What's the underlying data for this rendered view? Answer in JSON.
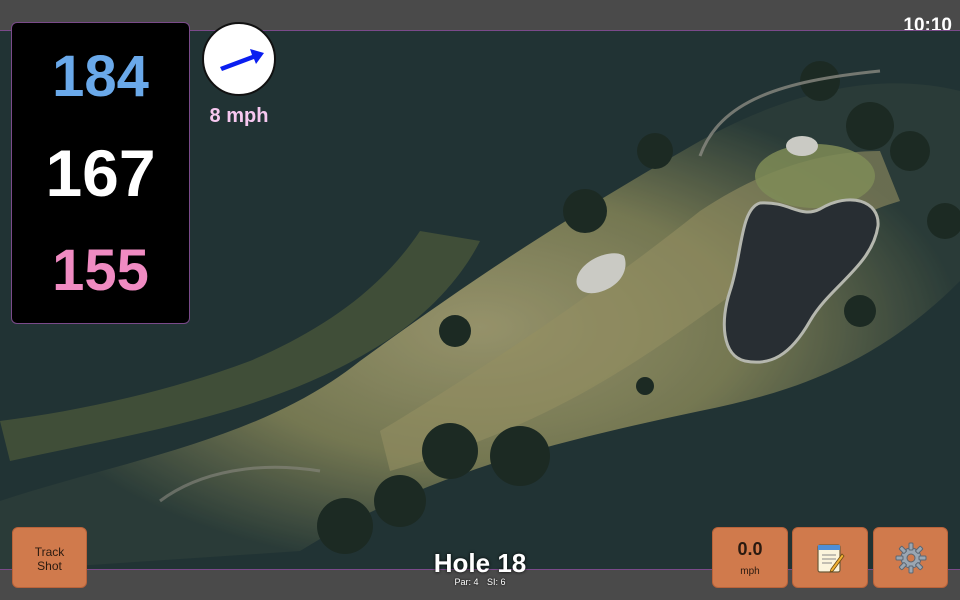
{
  "status": {
    "time": "10:10"
  },
  "distances": {
    "back": "184",
    "middle": "167",
    "front": "155"
  },
  "wind": {
    "speed": "8 mph",
    "icon": "wind-arrow-icon"
  },
  "hole": {
    "title": "Hole 18",
    "par": "Par: 4",
    "stroke_index": "SI: 6"
  },
  "buttons": {
    "track_shot_line1": "Track",
    "track_shot_line2": "Shot",
    "speed_value": "0.0",
    "speed_unit": "mph",
    "notes_icon": "notepad-icon",
    "settings_icon": "gear-icon"
  },
  "colors": {
    "back_distance": "#6aa9ea",
    "middle_distance": "#ffffff",
    "front_distance": "#f08bc2",
    "button": "#d07a4c",
    "wind_arrow": "#0a1ef0"
  }
}
